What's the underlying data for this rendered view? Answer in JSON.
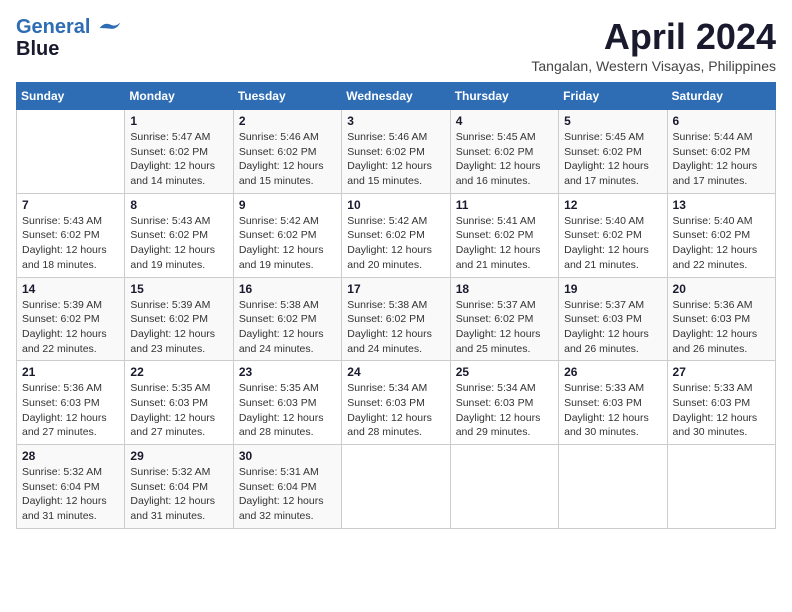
{
  "header": {
    "logo_line1": "General",
    "logo_line2": "Blue",
    "month": "April 2024",
    "location": "Tangalan, Western Visayas, Philippines"
  },
  "weekdays": [
    "Sunday",
    "Monday",
    "Tuesday",
    "Wednesday",
    "Thursday",
    "Friday",
    "Saturday"
  ],
  "weeks": [
    [
      {
        "day": "",
        "sunrise": "",
        "sunset": "",
        "daylight": ""
      },
      {
        "day": "1",
        "sunrise": "Sunrise: 5:47 AM",
        "sunset": "Sunset: 6:02 PM",
        "daylight": "Daylight: 12 hours and 14 minutes."
      },
      {
        "day": "2",
        "sunrise": "Sunrise: 5:46 AM",
        "sunset": "Sunset: 6:02 PM",
        "daylight": "Daylight: 12 hours and 15 minutes."
      },
      {
        "day": "3",
        "sunrise": "Sunrise: 5:46 AM",
        "sunset": "Sunset: 6:02 PM",
        "daylight": "Daylight: 12 hours and 15 minutes."
      },
      {
        "day": "4",
        "sunrise": "Sunrise: 5:45 AM",
        "sunset": "Sunset: 6:02 PM",
        "daylight": "Daylight: 12 hours and 16 minutes."
      },
      {
        "day": "5",
        "sunrise": "Sunrise: 5:45 AM",
        "sunset": "Sunset: 6:02 PM",
        "daylight": "Daylight: 12 hours and 17 minutes."
      },
      {
        "day": "6",
        "sunrise": "Sunrise: 5:44 AM",
        "sunset": "Sunset: 6:02 PM",
        "daylight": "Daylight: 12 hours and 17 minutes."
      }
    ],
    [
      {
        "day": "7",
        "sunrise": "Sunrise: 5:43 AM",
        "sunset": "Sunset: 6:02 PM",
        "daylight": "Daylight: 12 hours and 18 minutes."
      },
      {
        "day": "8",
        "sunrise": "Sunrise: 5:43 AM",
        "sunset": "Sunset: 6:02 PM",
        "daylight": "Daylight: 12 hours and 19 minutes."
      },
      {
        "day": "9",
        "sunrise": "Sunrise: 5:42 AM",
        "sunset": "Sunset: 6:02 PM",
        "daylight": "Daylight: 12 hours and 19 minutes."
      },
      {
        "day": "10",
        "sunrise": "Sunrise: 5:42 AM",
        "sunset": "Sunset: 6:02 PM",
        "daylight": "Daylight: 12 hours and 20 minutes."
      },
      {
        "day": "11",
        "sunrise": "Sunrise: 5:41 AM",
        "sunset": "Sunset: 6:02 PM",
        "daylight": "Daylight: 12 hours and 21 minutes."
      },
      {
        "day": "12",
        "sunrise": "Sunrise: 5:40 AM",
        "sunset": "Sunset: 6:02 PM",
        "daylight": "Daylight: 12 hours and 21 minutes."
      },
      {
        "day": "13",
        "sunrise": "Sunrise: 5:40 AM",
        "sunset": "Sunset: 6:02 PM",
        "daylight": "Daylight: 12 hours and 22 minutes."
      }
    ],
    [
      {
        "day": "14",
        "sunrise": "Sunrise: 5:39 AM",
        "sunset": "Sunset: 6:02 PM",
        "daylight": "Daylight: 12 hours and 22 minutes."
      },
      {
        "day": "15",
        "sunrise": "Sunrise: 5:39 AM",
        "sunset": "Sunset: 6:02 PM",
        "daylight": "Daylight: 12 hours and 23 minutes."
      },
      {
        "day": "16",
        "sunrise": "Sunrise: 5:38 AM",
        "sunset": "Sunset: 6:02 PM",
        "daylight": "Daylight: 12 hours and 24 minutes."
      },
      {
        "day": "17",
        "sunrise": "Sunrise: 5:38 AM",
        "sunset": "Sunset: 6:02 PM",
        "daylight": "Daylight: 12 hours and 24 minutes."
      },
      {
        "day": "18",
        "sunrise": "Sunrise: 5:37 AM",
        "sunset": "Sunset: 6:02 PM",
        "daylight": "Daylight: 12 hours and 25 minutes."
      },
      {
        "day": "19",
        "sunrise": "Sunrise: 5:37 AM",
        "sunset": "Sunset: 6:03 PM",
        "daylight": "Daylight: 12 hours and 26 minutes."
      },
      {
        "day": "20",
        "sunrise": "Sunrise: 5:36 AM",
        "sunset": "Sunset: 6:03 PM",
        "daylight": "Daylight: 12 hours and 26 minutes."
      }
    ],
    [
      {
        "day": "21",
        "sunrise": "Sunrise: 5:36 AM",
        "sunset": "Sunset: 6:03 PM",
        "daylight": "Daylight: 12 hours and 27 minutes."
      },
      {
        "day": "22",
        "sunrise": "Sunrise: 5:35 AM",
        "sunset": "Sunset: 6:03 PM",
        "daylight": "Daylight: 12 hours and 27 minutes."
      },
      {
        "day": "23",
        "sunrise": "Sunrise: 5:35 AM",
        "sunset": "Sunset: 6:03 PM",
        "daylight": "Daylight: 12 hours and 28 minutes."
      },
      {
        "day": "24",
        "sunrise": "Sunrise: 5:34 AM",
        "sunset": "Sunset: 6:03 PM",
        "daylight": "Daylight: 12 hours and 28 minutes."
      },
      {
        "day": "25",
        "sunrise": "Sunrise: 5:34 AM",
        "sunset": "Sunset: 6:03 PM",
        "daylight": "Daylight: 12 hours and 29 minutes."
      },
      {
        "day": "26",
        "sunrise": "Sunrise: 5:33 AM",
        "sunset": "Sunset: 6:03 PM",
        "daylight": "Daylight: 12 hours and 30 minutes."
      },
      {
        "day": "27",
        "sunrise": "Sunrise: 5:33 AM",
        "sunset": "Sunset: 6:03 PM",
        "daylight": "Daylight: 12 hours and 30 minutes."
      }
    ],
    [
      {
        "day": "28",
        "sunrise": "Sunrise: 5:32 AM",
        "sunset": "Sunset: 6:04 PM",
        "daylight": "Daylight: 12 hours and 31 minutes."
      },
      {
        "day": "29",
        "sunrise": "Sunrise: 5:32 AM",
        "sunset": "Sunset: 6:04 PM",
        "daylight": "Daylight: 12 hours and 31 minutes."
      },
      {
        "day": "30",
        "sunrise": "Sunrise: 5:31 AM",
        "sunset": "Sunset: 6:04 PM",
        "daylight": "Daylight: 12 hours and 32 minutes."
      },
      {
        "day": "",
        "sunrise": "",
        "sunset": "",
        "daylight": ""
      },
      {
        "day": "",
        "sunrise": "",
        "sunset": "",
        "daylight": ""
      },
      {
        "day": "",
        "sunrise": "",
        "sunset": "",
        "daylight": ""
      },
      {
        "day": "",
        "sunrise": "",
        "sunset": "",
        "daylight": ""
      }
    ]
  ]
}
